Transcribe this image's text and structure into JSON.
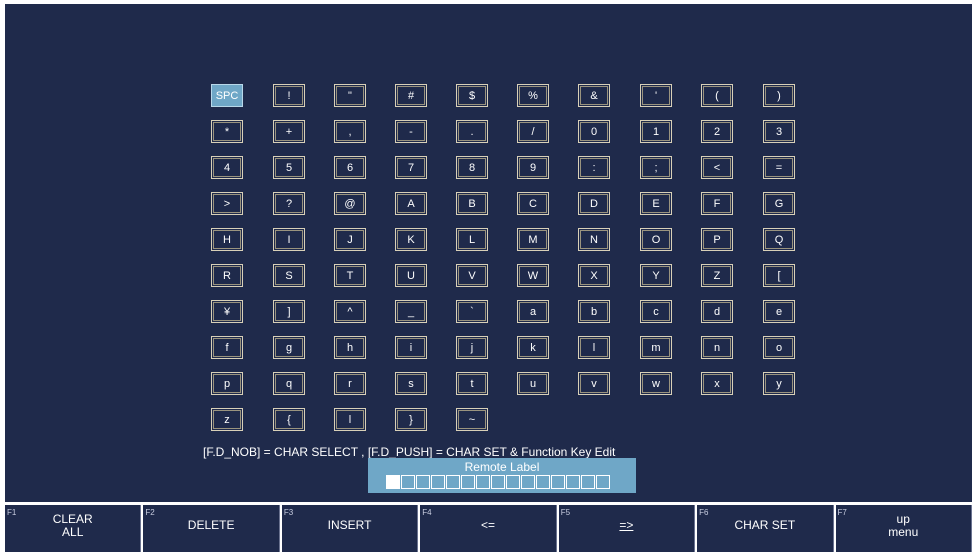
{
  "character_table": {
    "keys": [
      "SPC",
      "!",
      "\"",
      "#",
      "$",
      "%",
      "&",
      "'",
      "(",
      ")",
      "*",
      "+",
      ",",
      "-",
      ".",
      "/",
      "0",
      "1",
      "2",
      "3",
      "4",
      "5",
      "6",
      "7",
      "8",
      "9",
      ":",
      ";",
      "<",
      "=",
      ">",
      "?",
      "@",
      "A",
      "B",
      "C",
      "D",
      "E",
      "F",
      "G",
      "H",
      "I",
      "J",
      "K",
      "L",
      "M",
      "N",
      "O",
      "P",
      "Q",
      "R",
      "S",
      "T",
      "U",
      "V",
      "W",
      "X",
      "Y",
      "Z",
      "[",
      "¥",
      "]",
      "^",
      "_",
      "`",
      "a",
      "b",
      "c",
      "d",
      "e",
      "f",
      "g",
      "h",
      "i",
      "j",
      "k",
      "l",
      "m",
      "n",
      "o",
      "p",
      "q",
      "r",
      "s",
      "t",
      "u",
      "v",
      "w",
      "x",
      "y",
      "z",
      "{",
      "l",
      "}",
      "~"
    ],
    "selected_key": "SPC"
  },
  "help_text": "[F.D_NOB] = CHAR SELECT , [F.D_PUSH] = CHAR SET & Function Key Edit",
  "label_editor": {
    "title": "Remote Label",
    "cell_count": 15,
    "cursor_cell": 1
  },
  "function_keys": [
    {
      "number": "F1",
      "label": "CLEAR\nALL"
    },
    {
      "number": "F2",
      "label": "DELETE"
    },
    {
      "number": "F3",
      "label": "INSERT"
    },
    {
      "number": "F4",
      "label": "<="
    },
    {
      "number": "F5",
      "label": "=>"
    },
    {
      "number": "F6",
      "label": "CHAR SET"
    },
    {
      "number": "F7",
      "label": "up\nmenu"
    }
  ]
}
